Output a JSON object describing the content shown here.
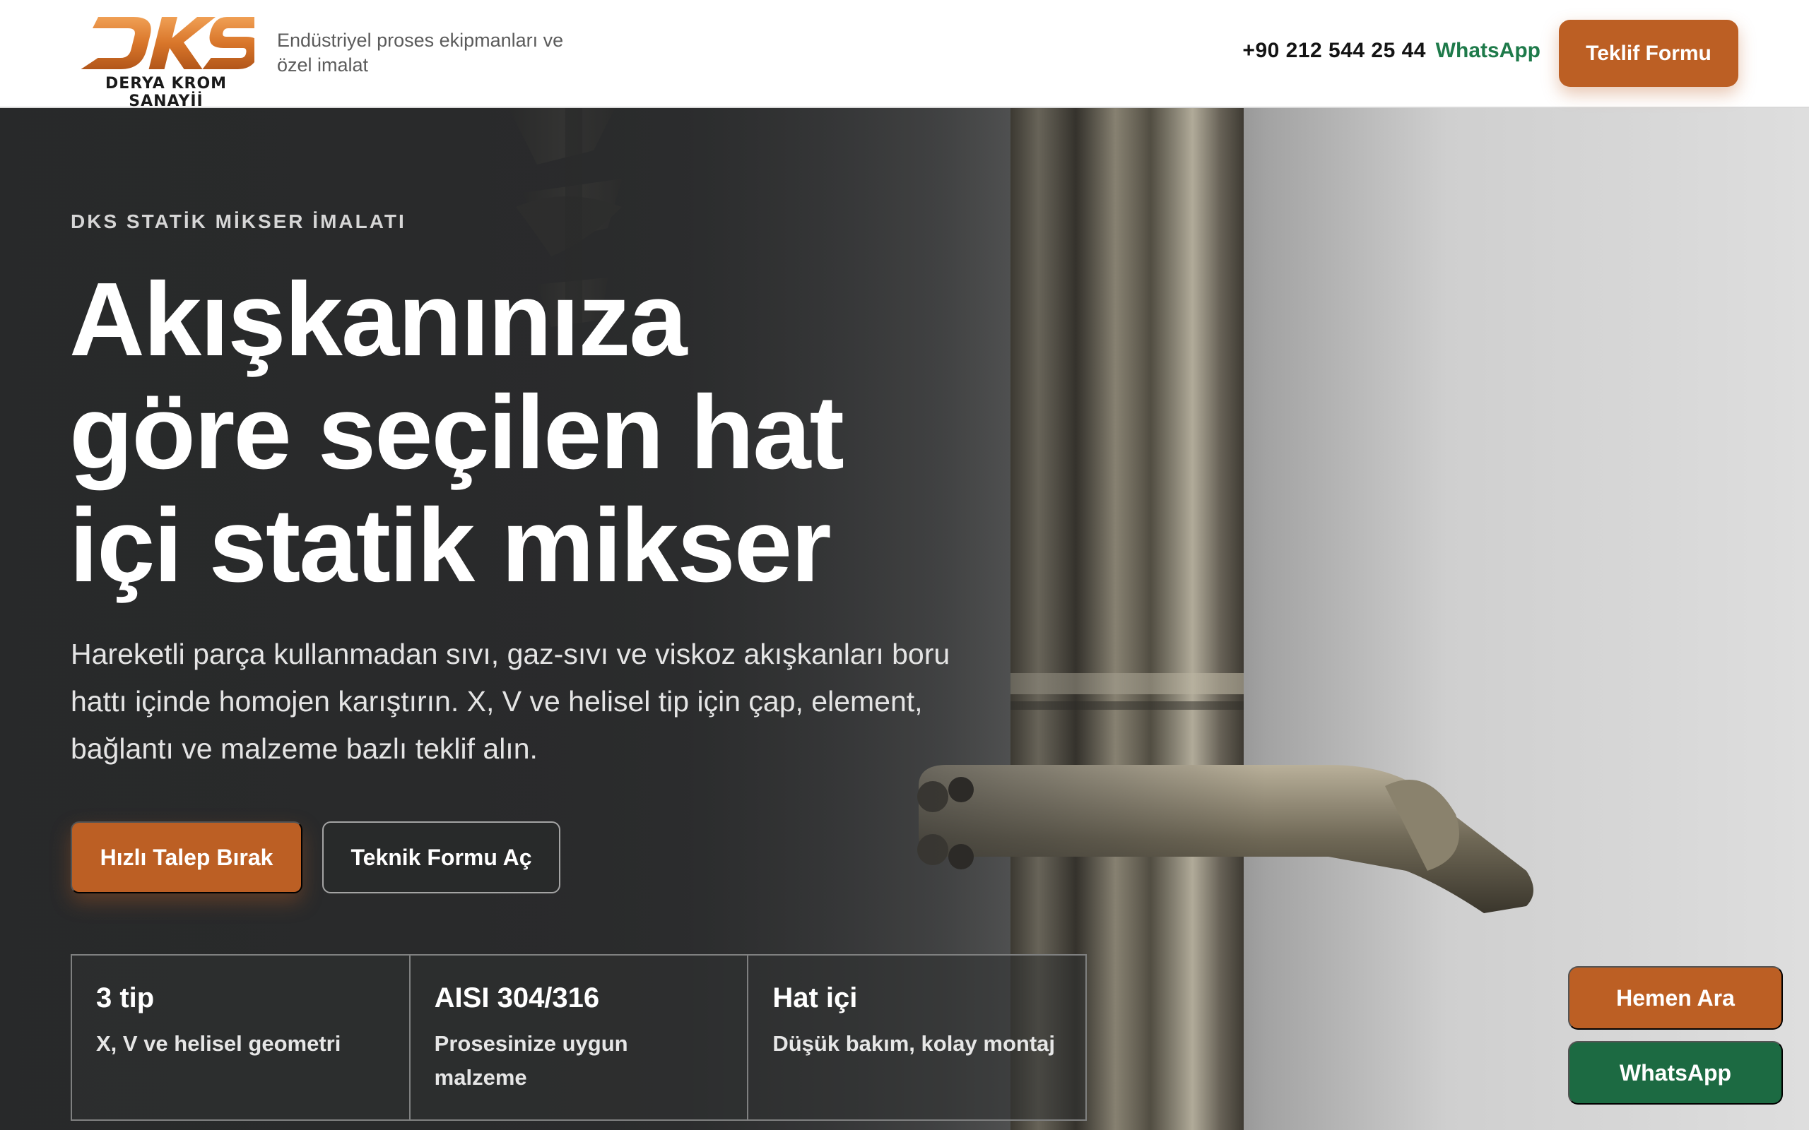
{
  "header": {
    "logo_text": "DKS",
    "logo_caption": "DERYA KROM SANAYİİ",
    "tagline": "Endüstriyel proses ekipmanları ve özel imalat",
    "phone": "+90 212 544 25 44",
    "whatsapp_label": "WhatsApp",
    "cta_label": "Teklif Formu"
  },
  "hero": {
    "kicker": "DKS STATİK MİKSER İMALATI",
    "title": "Akışkanınıza göre seçilen hat içi statik mikser",
    "description": "Hareketli parça kullanmadan sıvı, gaz-sıvı ve viskoz akışkanları boru hattı içinde homojen karıştırın. X, V ve helisel tip için çap, element, bağlantı ve malzeme bazlı teklif alın.",
    "primary_button": "Hızlı Talep Bırak",
    "secondary_button": "Teknik Formu Aç",
    "image_subject": "stainless-steel-static-mixer-pipe"
  },
  "stats": [
    {
      "title": "3 tip",
      "desc": "X, V ve helisel geometri"
    },
    {
      "title": "AISI 304/316",
      "desc": "Prosesinize uygun malzeme"
    },
    {
      "title": "Hat içi",
      "desc": "Düşük bakım, kolay montaj"
    }
  ],
  "floating": {
    "call_label": "Hemen Ara",
    "whatsapp_label": "WhatsApp"
  },
  "colors": {
    "accent": "#bc5f24",
    "whatsapp_green": "#1e7a4a",
    "whatsapp_button": "#1c6a42",
    "hero_dark": "#2e2f30"
  }
}
